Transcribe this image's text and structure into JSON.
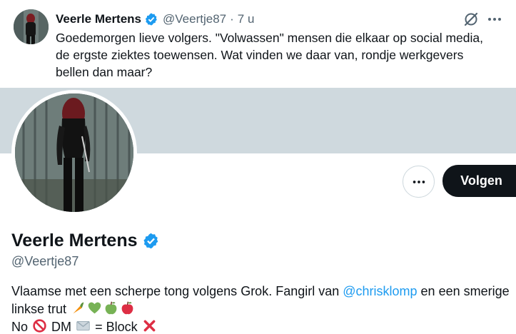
{
  "tweet": {
    "author_name": "Veerle Mertens",
    "handle": "@Veertje87",
    "separator": "·",
    "time": "7 u",
    "text": "Goedemorgen lieve volgers. \"Volwassen\" mensen die elkaar op social media, de ergste ziektes toewensen. Wat vinden we daar van, rondje werkgevers bellen dan maar?",
    "icons": [
      "grok-icon",
      "more-icon",
      "verified-badge-icon"
    ]
  },
  "profile": {
    "name": "Veerle Mertens",
    "handle": "@Veertje87",
    "follow_label": "Volgen",
    "banner_color": "#cfd9de",
    "bio": {
      "part1": "Vlaamse met een scherpe tong volgens Grok. Fangirl van ",
      "mention": "@chrisklomp",
      "part2": " en een smerige linkse trut",
      "line2_no": "No",
      "line2_dm": "DM",
      "line2_eq": "= Block"
    },
    "bio_emojis": [
      "carrot",
      "green-heart",
      "green-apple",
      "red-apple",
      "prohibited",
      "envelope",
      "cross-mark"
    ]
  },
  "colors": {
    "accent": "#1d9bf0",
    "text": "#0f1419",
    "secondary": "#536471",
    "button_dark": "#0f1419"
  }
}
